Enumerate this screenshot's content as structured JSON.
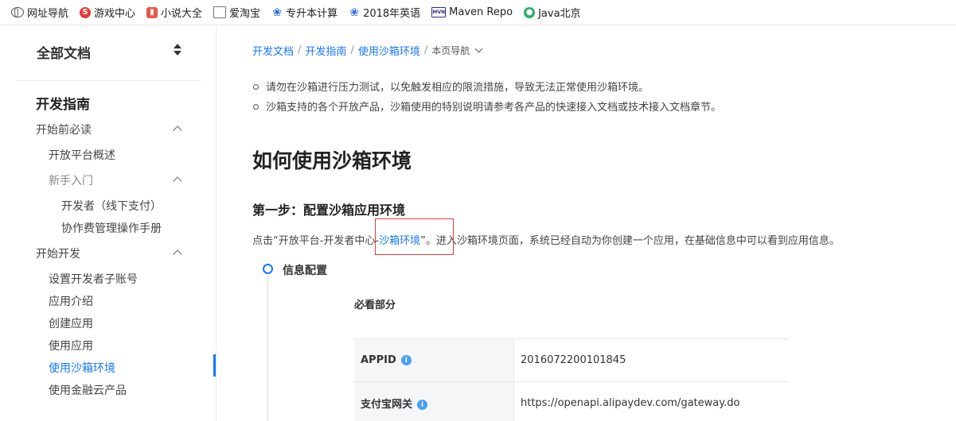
{
  "bookmarks": [
    {
      "label": "网址导航",
      "icon": "globe-icon"
    },
    {
      "label": "游戏中心",
      "icon": "game-icon"
    },
    {
      "label": "小说大全",
      "icon": "novel-icon"
    },
    {
      "label": "爱淘宝",
      "icon": "document-icon"
    },
    {
      "label": "专升本计算",
      "icon": "paw-icon"
    },
    {
      "label": "2018年英语",
      "icon": "paw-icon"
    },
    {
      "label": "Maven Repo",
      "icon": "maven-icon"
    },
    {
      "label": "Java北京",
      "icon": "wechat-icon"
    }
  ],
  "sidebar": {
    "all_docs": "全部文档",
    "heading": "开发指南",
    "items": [
      {
        "label": "开始前必读"
      },
      {
        "label": "开放平台概述"
      },
      {
        "label": "新手入门"
      },
      {
        "label": "开发者（线下支付）"
      },
      {
        "label": "协作费管理操作手册"
      },
      {
        "label": "开始开发"
      },
      {
        "label": "设置开发者子账号"
      },
      {
        "label": "应用介绍"
      },
      {
        "label": "创建应用"
      },
      {
        "label": "使用应用"
      },
      {
        "label": "使用沙箱环境"
      },
      {
        "label": "使用金融云产品"
      }
    ]
  },
  "breadcrumb": {
    "items": [
      "开发文档",
      "开发指南",
      "使用沙箱环境"
    ],
    "current": "本页导航"
  },
  "content": {
    "bullets": [
      "请勿在沙箱进行压力测试，以免触发相应的限流措施，导致无法正常使用沙箱环境。",
      "沙箱支持的各个开放产品，沙箱使用的特别说明请参考各产品的快速接入文档或技术接入文档章节。"
    ],
    "title": "如何使用沙箱环境",
    "step_title": "第一步：配置沙箱应用环境",
    "para_before": "点击“开放平台-开发者中心-",
    "para_link": "沙箱环境",
    "para_after": "”。进入沙箱环境页面，系统已经自动为你创建一个应用，在基础信息中可以看到应用信息。",
    "timeline_step": "信息配置",
    "must_read": "必看部分",
    "table": [
      {
        "key": "APPID",
        "value": "2016072200101845"
      },
      {
        "key": "支付宝网关",
        "value": "https://openapi.alipaydev.com/gateway.do"
      }
    ]
  },
  "colors": {
    "link": "#1677ff",
    "highlight_box": "#e53935"
  }
}
